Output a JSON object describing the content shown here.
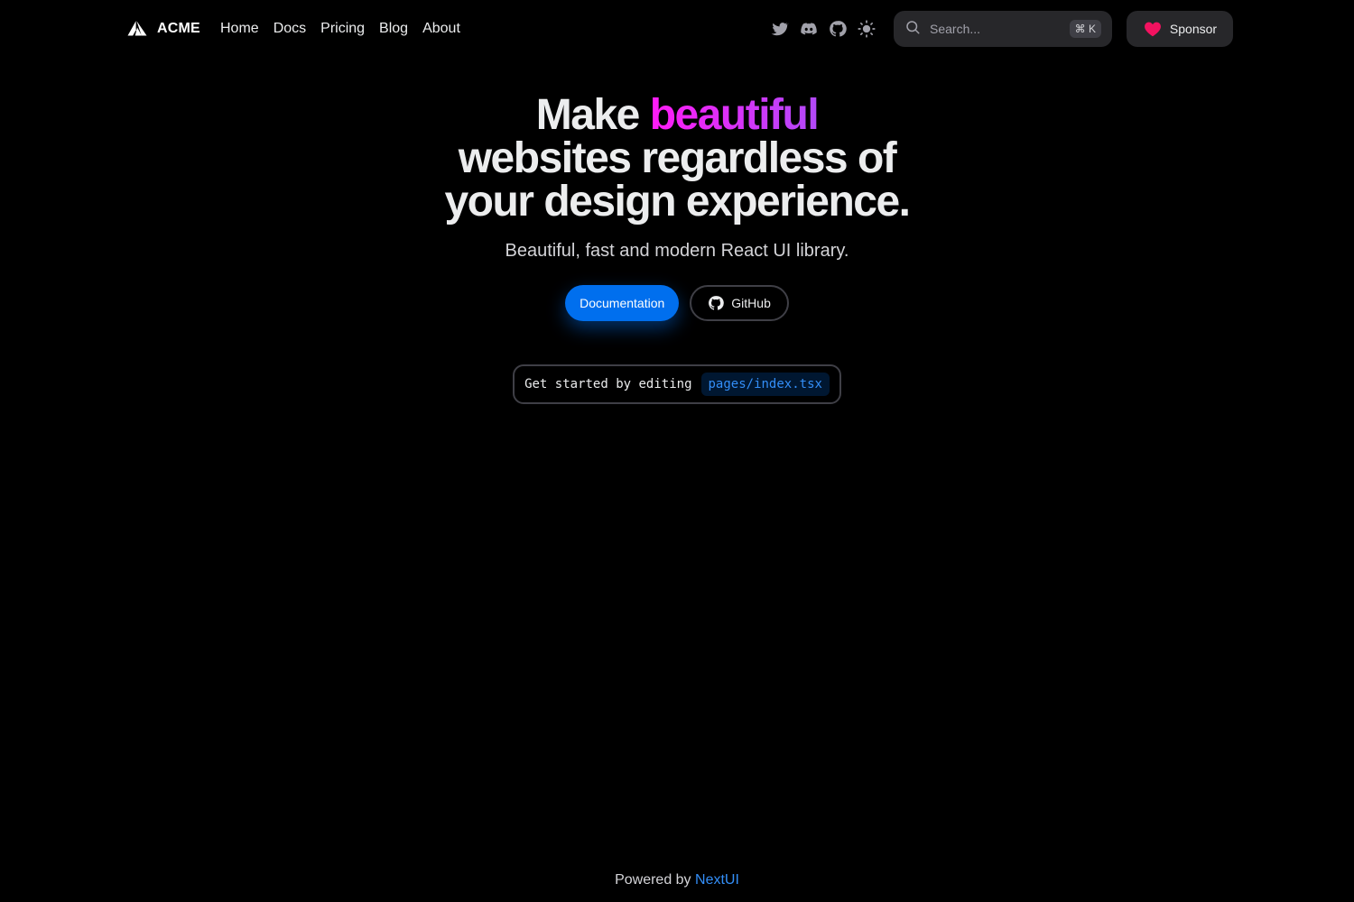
{
  "navbar": {
    "brand": {
      "name": "ACME",
      "logo_icon": "acme-triangle-logo"
    },
    "links": [
      {
        "label": "Home"
      },
      {
        "label": "Docs"
      },
      {
        "label": "Pricing"
      },
      {
        "label": "Blog"
      },
      {
        "label": "About"
      }
    ],
    "icons": [
      "twitter-icon",
      "discord-icon",
      "github-icon",
      "theme-toggle-sun-icon"
    ],
    "search": {
      "placeholder": "Search...",
      "shortcut": "⌘ K"
    },
    "sponsor": {
      "label": "Sponsor",
      "icon": "heart-icon",
      "icon_color": "#F31260"
    }
  },
  "hero": {
    "title_part1": "Make ",
    "title_accent": "beautiful",
    "title_line2": "websites regardless of",
    "title_line3": "your design experience.",
    "subtitle": "Beautiful, fast and modern React UI library.",
    "primary_button": "Documentation",
    "secondary_button": "GitHub",
    "snippet_text": "Get started by editing",
    "snippet_code": "pages/index.tsx"
  },
  "footer": {
    "text": "Powered by",
    "link": "NextUI"
  },
  "colors": {
    "background": "#000000",
    "primary": "#006FEE",
    "accent_gradient_start": "#FF1CF7",
    "accent_gradient_end": "#B249F8",
    "code_text": "#338EF7"
  }
}
